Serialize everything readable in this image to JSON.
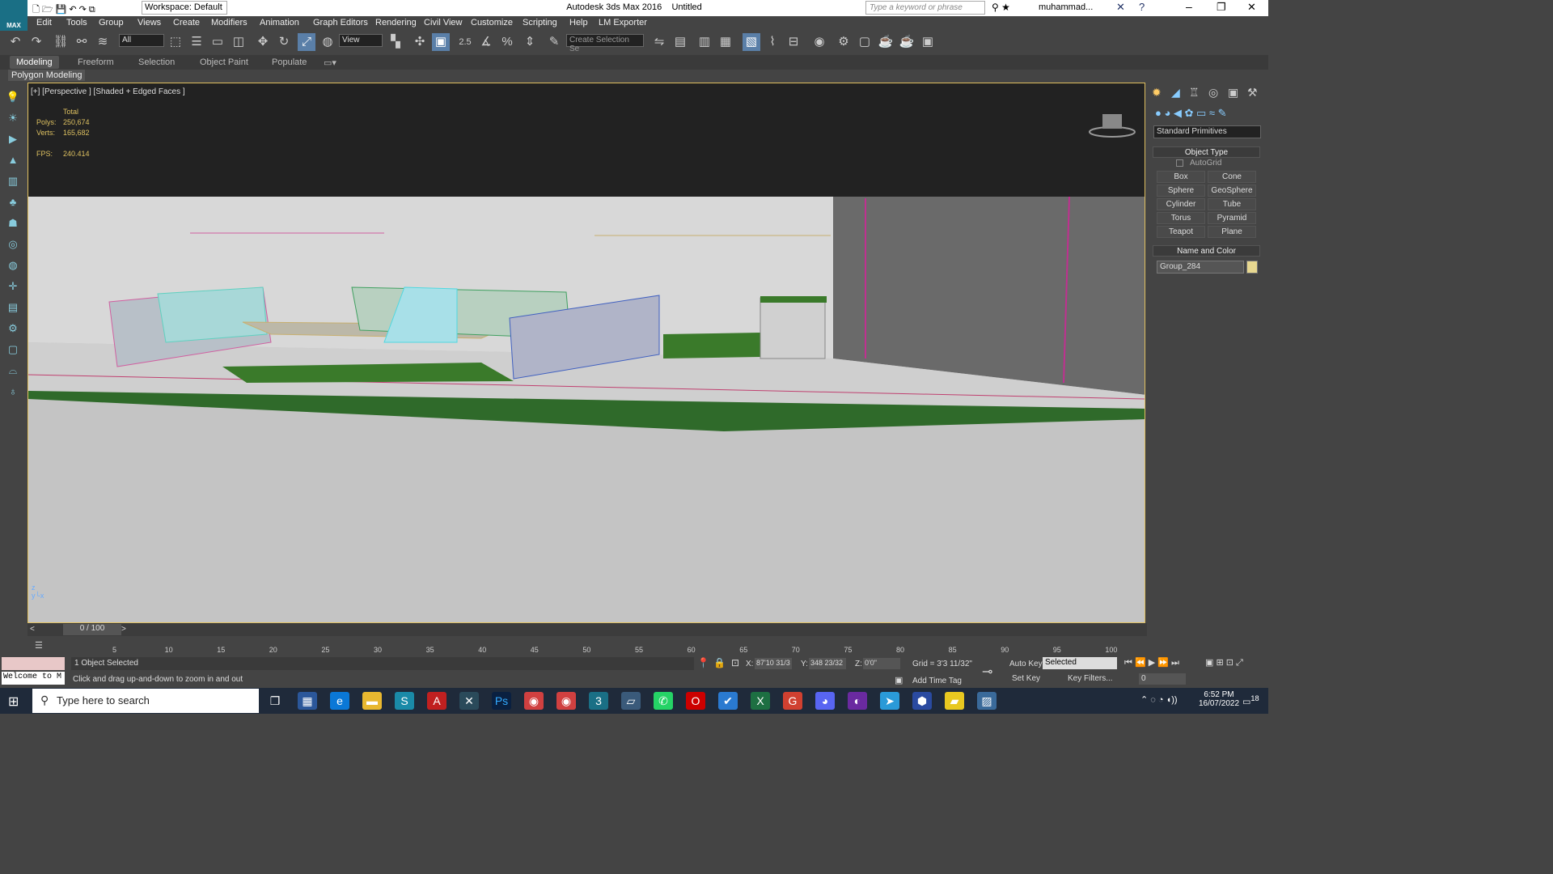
{
  "window": {
    "title": "Autodesk 3ds Max 2016",
    "document": "Untitled",
    "workspace": "Workspace: Default",
    "search_placeholder": "Type a keyword or phrase",
    "user": "muhammad..."
  },
  "menu": [
    "Edit",
    "Tools",
    "Group",
    "Views",
    "Create",
    "Modifiers",
    "Animation",
    "Graph Editors",
    "Rendering",
    "Civil View",
    "Customize",
    "Scripting",
    "Help",
    "LM Exporter"
  ],
  "toolbar": {
    "filter": "All",
    "ref_coord": "View",
    "selection_set": "Create Selection Se",
    "snap_label": "2.5"
  },
  "ribbon": {
    "tabs": [
      "Modeling",
      "Freeform",
      "Selection",
      "Object Paint",
      "Populate"
    ],
    "sub": "Polygon Modeling"
  },
  "viewport": {
    "label": "[+] [Perspective ] [Shaded + Edged Faces ]",
    "stats_total": "Total",
    "polys_label": "Polys:",
    "polys": "250,674",
    "verts_label": "Verts:",
    "verts": "165,682",
    "fps_label": "FPS:",
    "fps": "240.414"
  },
  "command_panel": {
    "dropdown": "Standard Primitives",
    "object_type": "Object Type",
    "autogrid": "AutoGrid",
    "primitives": [
      "Box",
      "Cone",
      "Sphere",
      "GeoSphere",
      "Cylinder",
      "Tube",
      "Torus",
      "Pyramid",
      "Teapot",
      "Plane"
    ],
    "name_color": "Name and Color",
    "object_name": "Group_284",
    "object_color": "#e8d890"
  },
  "timeline": {
    "frame": "0 / 100",
    "ticks": [
      "5",
      "10",
      "15",
      "20",
      "25",
      "30",
      "35",
      "40",
      "45",
      "50",
      "55",
      "60",
      "65",
      "70",
      "75",
      "80",
      "85",
      "90",
      "95",
      "100"
    ]
  },
  "status": {
    "selected": "1 Object Selected",
    "prompt": "Click and drag up-and-down to zoom in and out",
    "listener": "Welcome to M",
    "x_label": "X:",
    "x": "87'10 31/3",
    "y_label": "Y:",
    "y": "348 23/32",
    "z_label": "Z:",
    "z": "0'0\"",
    "grid": "Grid = 3'3 11/32\"",
    "add_time_tag": "Add Time Tag",
    "auto_key": "Auto Key",
    "set_key": "Set Key",
    "key_mode": "Selected",
    "key_filters": "Key Filters...",
    "frame_field": "0"
  },
  "taskbar": {
    "search": "Type here to search",
    "time": "6:52 PM",
    "date": "16/07/2022",
    "notif": "18"
  }
}
